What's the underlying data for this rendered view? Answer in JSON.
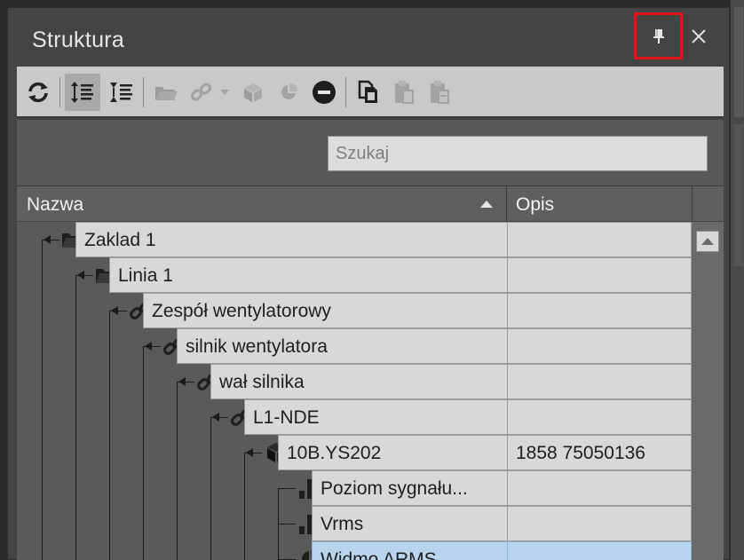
{
  "window": {
    "title": "Struktura"
  },
  "colors": {
    "highlight_border": "#e0141b",
    "selected_row": "#b9d5ee"
  },
  "toolbar": {
    "items": [
      {
        "name": "refresh-icon",
        "enabled": true
      },
      {
        "name": "expand-all-icon",
        "enabled": true,
        "active": true
      },
      {
        "name": "collapse-all-icon",
        "enabled": true
      },
      {
        "name": "folder-icon",
        "enabled": false
      },
      {
        "name": "link-icon",
        "enabled": false
      },
      {
        "name": "dropdown-arrow-icon",
        "enabled": false
      },
      {
        "name": "cube-icon",
        "enabled": false
      },
      {
        "name": "pie-chart-icon",
        "enabled": false
      },
      {
        "name": "remove-icon",
        "enabled": true
      },
      {
        "name": "copy-icon",
        "enabled": true
      },
      {
        "name": "paste-icon",
        "enabled": false
      },
      {
        "name": "paste-special-icon",
        "enabled": false
      }
    ]
  },
  "search": {
    "placeholder": "Szukaj",
    "value": ""
  },
  "columns": {
    "name": "Nazwa",
    "description": "Opis"
  },
  "tree": [
    {
      "level": 0,
      "icon": "folder-icon",
      "label": "Zaklad 1",
      "description": ""
    },
    {
      "level": 1,
      "icon": "folder-icon",
      "label": "Linia 1",
      "description": ""
    },
    {
      "level": 2,
      "icon": "link-icon",
      "label": "Zespół wentylatorowy",
      "description": ""
    },
    {
      "level": 3,
      "icon": "link-icon",
      "label": "silnik wentylatora",
      "description": ""
    },
    {
      "level": 4,
      "icon": "link-icon",
      "label": "wał silnika",
      "description": ""
    },
    {
      "level": 5,
      "icon": "link-icon",
      "label": "L1-NDE",
      "description": ""
    },
    {
      "level": 6,
      "icon": "cube-icon",
      "label": "10B.YS202",
      "description": "1858 75050136"
    },
    {
      "level": 7,
      "icon": "bar-chart-icon",
      "label": "Poziom sygnału...",
      "description": ""
    },
    {
      "level": 7,
      "icon": "bar-chart-icon",
      "label": "Vrms",
      "description": ""
    },
    {
      "level": 7,
      "icon": "pie-chart-icon",
      "label": "Widmo ARMS",
      "description": "",
      "selected": true
    }
  ]
}
